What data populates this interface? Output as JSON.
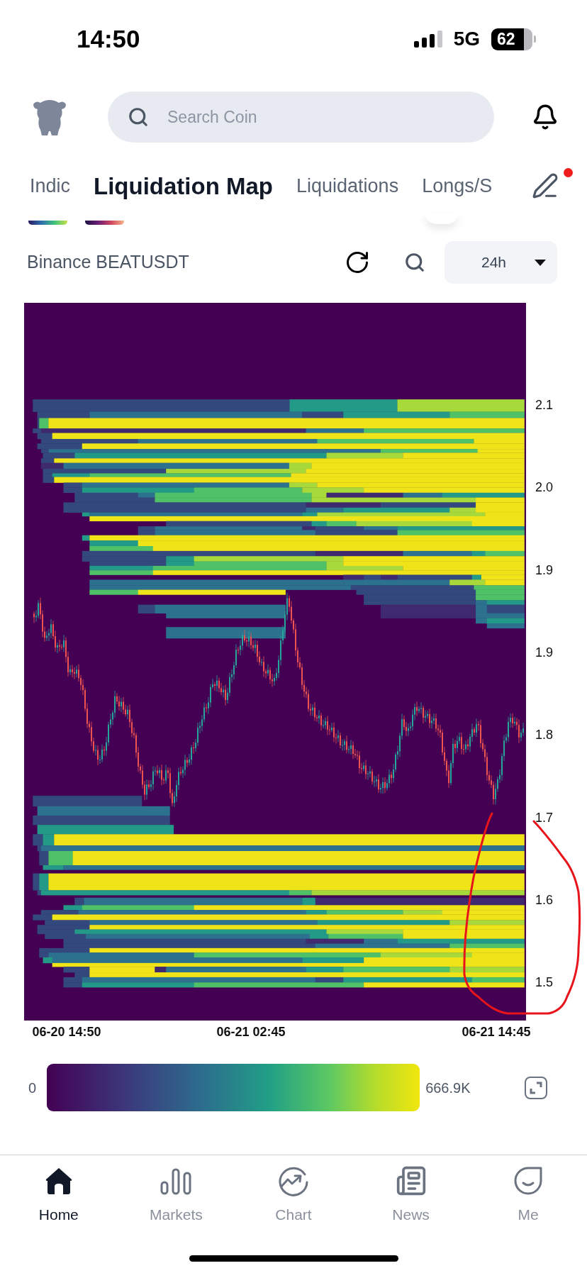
{
  "status_bar": {
    "time": "14:50",
    "network": "5G",
    "battery": "62"
  },
  "header": {
    "search": {
      "placeholder": "Search Coin"
    }
  },
  "tabs": [
    {
      "label": "Indic",
      "selected": false
    },
    {
      "label": "Liquidation Map",
      "selected": true
    },
    {
      "label": "Liquidations",
      "selected": false
    },
    {
      "label": "Longs/S",
      "selected": false
    }
  ],
  "edit": {
    "badge": true
  },
  "toolbar": {
    "pair": "Binance BEATUSDT",
    "range": "24h"
  },
  "chart": {
    "y_labels": [
      "2.1",
      "2.0",
      "1.9",
      "1.9",
      "1.8",
      "1.7",
      "1.6",
      "1.5"
    ],
    "x_labels": [
      "06-20 14:50",
      "06-21 02:45",
      "06-21 14:45"
    ]
  },
  "color_scale": {
    "min": "0",
    "max": "666.9K"
  },
  "bottom_nav": [
    {
      "label": "Home",
      "selected": true
    },
    {
      "label": "Markets",
      "selected": false
    },
    {
      "label": "Chart",
      "selected": false
    },
    {
      "label": "News",
      "selected": false
    },
    {
      "label": "Me",
      "selected": false
    }
  ]
}
